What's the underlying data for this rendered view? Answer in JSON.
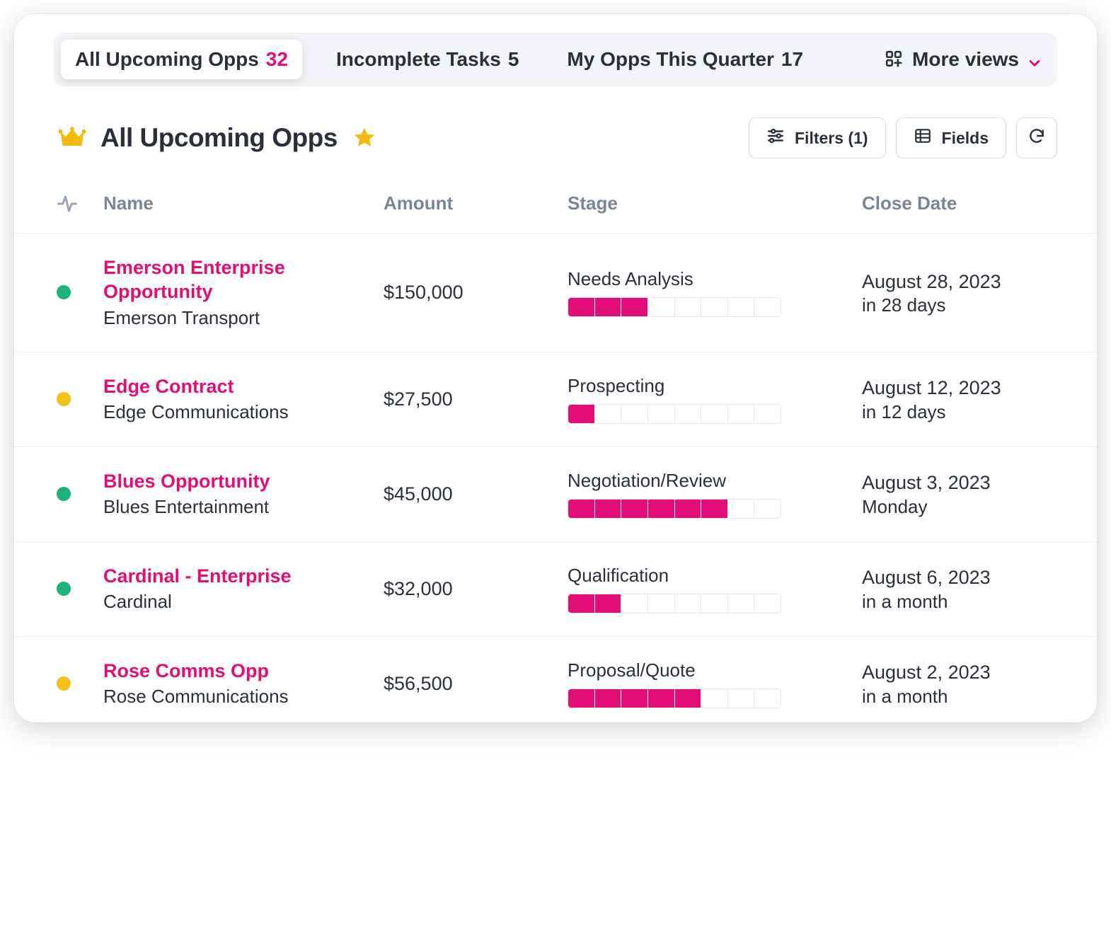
{
  "colors": {
    "accent": "#e20d77",
    "green": "#1ab37a",
    "yellow": "#f2c216",
    "star": "#f2b90f",
    "crown": "#f2b90f"
  },
  "tabs": [
    {
      "label": "All Upcoming Opps",
      "count": "32",
      "active": true
    },
    {
      "label": "Incomplete Tasks",
      "count": "5",
      "active": false
    },
    {
      "label": "My Opps This Quarter",
      "count": "17",
      "active": false
    }
  ],
  "more_views_label": "More views",
  "title": "All Upcoming Opps",
  "toolbar": {
    "filters_label": "Filters (1)",
    "fields_label": "Fields"
  },
  "columns": {
    "name": "Name",
    "amount": "Amount",
    "stage": "Stage",
    "close_date": "Close Date"
  },
  "stage_segments": 8,
  "rows": [
    {
      "status_color": "green",
      "name": "Emerson Enterprise Opportunity",
      "account": "Emerson Transport",
      "amount": "$150,000",
      "stage_label": "Needs Analysis",
      "stage_filled": 3,
      "close_date": "August 28, 2023",
      "close_relative": "in 28 days"
    },
    {
      "status_color": "yellow",
      "name": "Edge Contract",
      "account": "Edge Communications",
      "amount": "$27,500",
      "stage_label": "Prospecting",
      "stage_filled": 1,
      "close_date": "August 12, 2023",
      "close_relative": "in 12 days"
    },
    {
      "status_color": "green",
      "name": "Blues Opportunity",
      "account": "Blues Entertainment",
      "amount": "$45,000",
      "stage_label": "Negotiation/Review",
      "stage_filled": 6,
      "close_date": "August 3, 2023",
      "close_relative": "Monday"
    },
    {
      "status_color": "green",
      "name": "Cardinal - Enterprise",
      "account": "Cardinal",
      "amount": "$32,000",
      "stage_label": "Qualification",
      "stage_filled": 2,
      "close_date": "August 6, 2023",
      "close_relative": "in a month"
    },
    {
      "status_color": "yellow",
      "name": "Rose Comms Opp",
      "account": "Rose Communications",
      "amount": "$56,500",
      "stage_label": "Proposal/Quote",
      "stage_filled": 5,
      "close_date": "August 2, 2023",
      "close_relative": "in a month"
    }
  ]
}
